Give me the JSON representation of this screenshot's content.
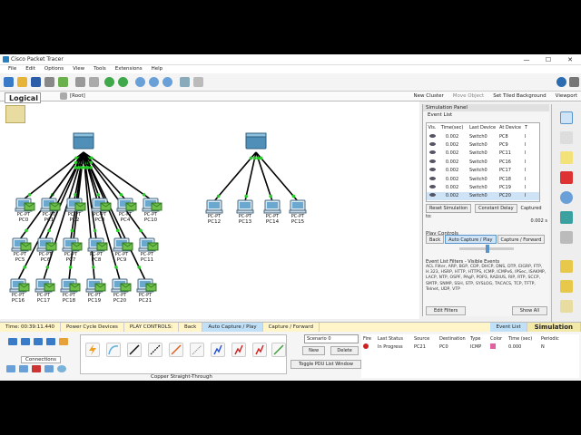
{
  "window": {
    "title": "Cisco Packet Tracer",
    "controls": [
      "—",
      "☐",
      "✕"
    ]
  },
  "menu": [
    "File",
    "Edit",
    "Options",
    "View",
    "Tools",
    "Extensions",
    "Help"
  ],
  "workspace": {
    "tab": "Logical",
    "root": "[Root]",
    "actions": [
      "New Cluster",
      "Move Object",
      "Set Tiled Background",
      "Viewport"
    ]
  },
  "devices": {
    "pcs_left": [
      "PC0",
      "PC1",
      "PC2",
      "PC3",
      "PC4",
      "PC10",
      "PC5",
      "PC6",
      "PC7",
      "PC8",
      "PC9",
      "PC11",
      "PC16",
      "PC17",
      "PC18",
      "PC19",
      "PC20",
      "PC21"
    ],
    "pcs_right": [
      "PC12",
      "PC13",
      "PC14",
      "PC15"
    ],
    "pc_model": "PC-PT"
  },
  "simulation_panel": {
    "title": "Simulation Panel",
    "event_list_label": "Event List",
    "columns": [
      "Vis.",
      "Time(sec)",
      "Last Device",
      "At Device",
      "T"
    ],
    "events": [
      {
        "time": "0.002",
        "last": "Switch0",
        "at": "PC8",
        "t": "I"
      },
      {
        "time": "0.002",
        "last": "Switch0",
        "at": "PC9",
        "t": "I"
      },
      {
        "time": "0.002",
        "last": "Switch0",
        "at": "PC11",
        "t": "I"
      },
      {
        "time": "0.002",
        "last": "Switch0",
        "at": "PC16",
        "t": "I"
      },
      {
        "time": "0.002",
        "last": "Switch0",
        "at": "PC17",
        "t": "I"
      },
      {
        "time": "0.002",
        "last": "Switch0",
        "at": "PC18",
        "t": "I"
      },
      {
        "time": "0.002",
        "last": "Switch0",
        "at": "PC19",
        "t": "I"
      },
      {
        "time": "0.002",
        "last": "Switch0",
        "at": "PC20",
        "t": "I"
      }
    ],
    "reset_label": "Reset Simulation",
    "constant_delay_label": "Constant Delay",
    "captured_label": "Captured to:",
    "captured_value": "0.002 s",
    "play_controls_label": "Play Controls",
    "back": "Back",
    "auto_capture": "Auto Capture / Play",
    "capture_forward": "Capture / Forward",
    "filters_label": "Event List Filters - Visible Events",
    "filters_text": "ACL Filter, ARP, BGP, CDP, DHCP, DNS, DTP, EIGRP, FTP, H.323, HSRP, HTTP, HTTPS, ICMP, ICMPv6, IPSec, ISAKMP, LACP, NTP, OSPF, PAgP, POP3, RADIUS, RIP, RTP, SCCP, SMTP, SNMP, SSH, STP, SYSLOG, TACACS, TCP, TFTP, Telnet, UDP, VTP",
    "edit_filters": "Edit Filters",
    "show_all": "Show All"
  },
  "statusbar": {
    "time": "Time: 00:39:11.440",
    "power": "Power Cycle Devices",
    "play_controls": "PLAY CONTROLS:",
    "back": "Back",
    "auto_capture": "Auto Capture / Play",
    "capture_forward": "Capture / Forward",
    "event_list": "Event List",
    "simulation": "Simulation"
  },
  "bottom": {
    "connections_label": "Connections",
    "cable_label": "Copper Straight-Through",
    "scenario_value": "Scenario 0",
    "new_label": "New",
    "delete_label": "Delete",
    "toggle_label": "Toggle PDU List Window",
    "pdu_columns": [
      "Fire",
      "Last Status",
      "Source",
      "Destination",
      "Type",
      "Color",
      "Time (sec)",
      "Periodic"
    ],
    "pdu_row": {
      "status": "In Progress",
      "source": "PC21",
      "destination": "PC0",
      "type": "ICMP",
      "time": "0.000",
      "periodic": "N"
    }
  },
  "colors": {
    "accent": "#5a93c8",
    "link_up": "#22cc22",
    "status_bg": "#fff5c8"
  }
}
